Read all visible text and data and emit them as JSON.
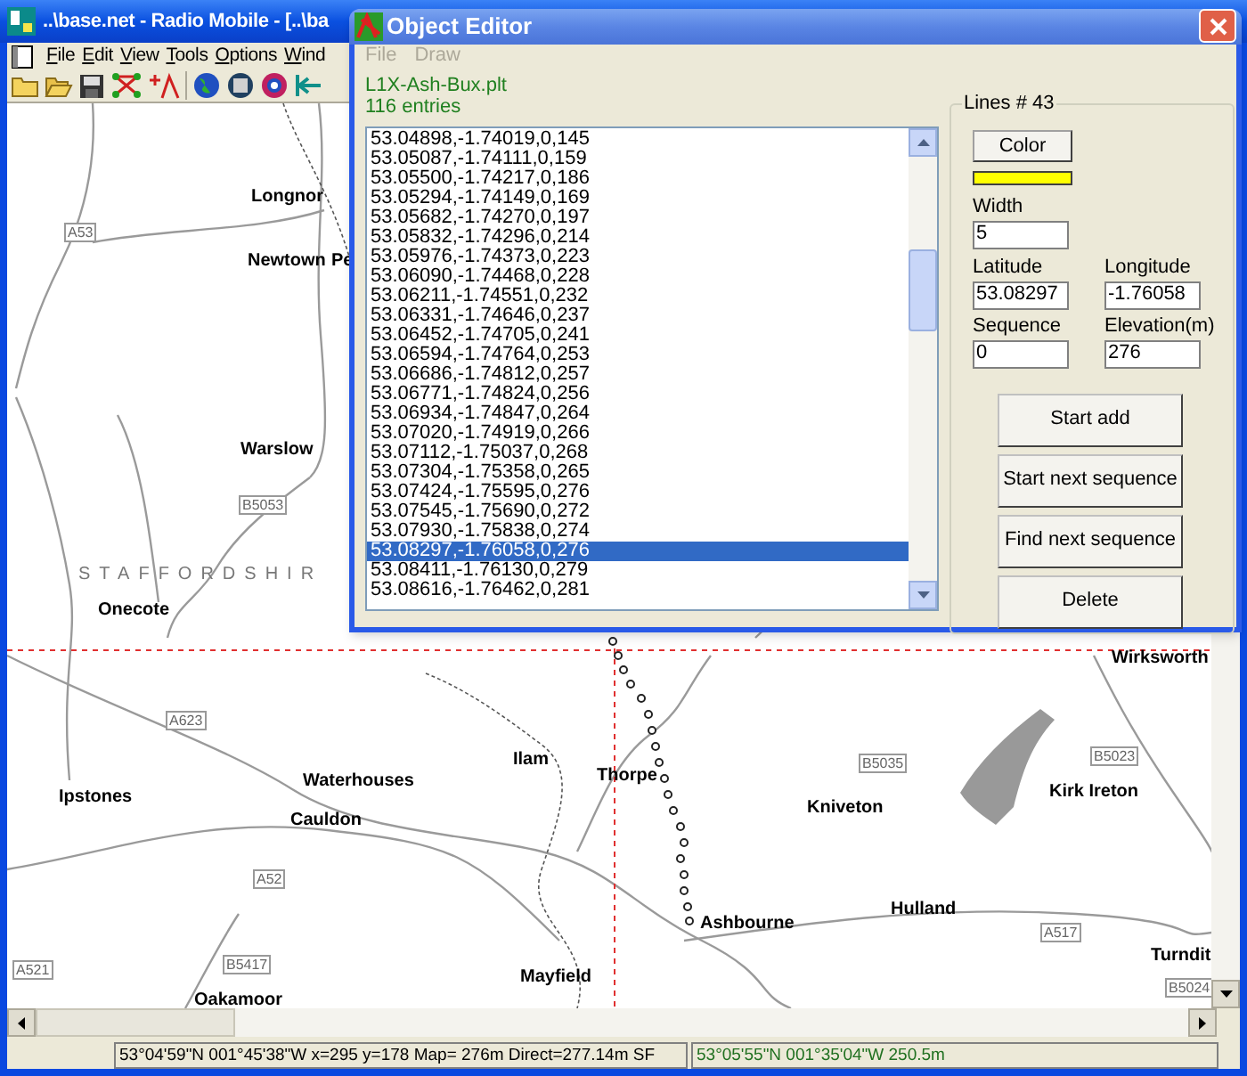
{
  "main_window": {
    "title": "..\\base.net - Radio Mobile - [..\\ba"
  },
  "menu": [
    "File",
    "Edit",
    "View",
    "Tools",
    "Options",
    "Wind"
  ],
  "map": {
    "labels": [
      {
        "text": "Longnor",
        "kind": "town"
      },
      {
        "text": "Newtown",
        "kind": "town"
      },
      {
        "text": "Pe",
        "kind": "town"
      },
      {
        "text": "A53",
        "kind": "road"
      },
      {
        "text": "Warslow",
        "kind": "town"
      },
      {
        "text": "B5053",
        "kind": "road"
      },
      {
        "text": "STAFFORDSHIR",
        "kind": "county"
      },
      {
        "text": "Onecote",
        "kind": "town"
      },
      {
        "text": "Wirksworth",
        "kind": "town"
      },
      {
        "text": "A623",
        "kind": "road"
      },
      {
        "text": "Ilam",
        "kind": "town"
      },
      {
        "text": "Thorpe",
        "kind": "town"
      },
      {
        "text": "B5035",
        "kind": "road"
      },
      {
        "text": "B5023",
        "kind": "road"
      },
      {
        "text": "Waterhouses",
        "kind": "town"
      },
      {
        "text": "Ipstones",
        "kind": "town"
      },
      {
        "text": "Kirk Ireton",
        "kind": "town"
      },
      {
        "text": "Kniveton",
        "kind": "town"
      },
      {
        "text": "Cauldon",
        "kind": "town"
      },
      {
        "text": "A52",
        "kind": "road"
      },
      {
        "text": "Hulland",
        "kind": "town"
      },
      {
        "text": "Ashbourne",
        "kind": "town"
      },
      {
        "text": "A517",
        "kind": "road"
      },
      {
        "text": "B5417",
        "kind": "road"
      },
      {
        "text": "A521",
        "kind": "road"
      },
      {
        "text": "Turndit",
        "kind": "town"
      },
      {
        "text": "Mayfield",
        "kind": "town"
      },
      {
        "text": "B5024",
        "kind": "road"
      },
      {
        "text": "Oakamoor",
        "kind": "town"
      }
    ]
  },
  "status_bar": {
    "cursor": "53°04'59\"N  001°45'38\"W  x=295 y=178 Map= 276m Direct=277.14m SF",
    "marker": "53°05'55\"N 001°35'04\"W 250.5m"
  },
  "object_editor": {
    "title": "Object Editor",
    "menu": [
      {
        "label": "File",
        "disabled": true
      },
      {
        "label": "Draw",
        "disabled": true
      }
    ],
    "file_name": "L1X-Ash-Bux.plt",
    "entry_count": "116 entries",
    "points": [
      {
        "text": "53.04898,-1.74019,0,145",
        "selected": false
      },
      {
        "text": "53.05087,-1.74111,0,159",
        "selected": false
      },
      {
        "text": "53.05500,-1.74217,0,186",
        "selected": false
      },
      {
        "text": "53.05294,-1.74149,0,169",
        "selected": false
      },
      {
        "text": "53.05682,-1.74270,0,197",
        "selected": false
      },
      {
        "text": "53.05832,-1.74296,0,214",
        "selected": false
      },
      {
        "text": "53.05976,-1.74373,0,223",
        "selected": false
      },
      {
        "text": "53.06090,-1.74468,0,228",
        "selected": false
      },
      {
        "text": "53.06211,-1.74551,0,232",
        "selected": false
      },
      {
        "text": "53.06331,-1.74646,0,237",
        "selected": false
      },
      {
        "text": "53.06452,-1.74705,0,241",
        "selected": false
      },
      {
        "text": "53.06594,-1.74764,0,253",
        "selected": false
      },
      {
        "text": "53.06686,-1.74812,0,257",
        "selected": false
      },
      {
        "text": "53.06771,-1.74824,0,256",
        "selected": false
      },
      {
        "text": "53.06934,-1.74847,0,264",
        "selected": false
      },
      {
        "text": "53.07020,-1.74919,0,266",
        "selected": false
      },
      {
        "text": "53.07112,-1.75037,0,268",
        "selected": false
      },
      {
        "text": "53.07304,-1.75358,0,265",
        "selected": false
      },
      {
        "text": "53.07424,-1.75595,0,276",
        "selected": false
      },
      {
        "text": "53.07545,-1.75690,0,272",
        "selected": false
      },
      {
        "text": "53.07930,-1.75838,0,274",
        "selected": false
      },
      {
        "text": "53.08297,-1.76058,0,276",
        "selected": true
      },
      {
        "text": "53.08411,-1.76130,0,279",
        "selected": false
      },
      {
        "text": "53.08616,-1.76462,0,281",
        "selected": false
      }
    ],
    "group_title": "Lines # 43",
    "color_button": "Color",
    "swatch": {
      "color": "#ffff00"
    },
    "width": {
      "label": "Width",
      "value": "5"
    },
    "fields": [
      {
        "label": "Latitude",
        "value": "53.08297"
      },
      {
        "label": "Longitude",
        "value": "-1.76058"
      },
      {
        "label": "Sequence",
        "value": "0"
      },
      {
        "label": "Elevation(m)",
        "value": "276"
      }
    ],
    "buttons": [
      "Start add",
      "Start next sequence",
      "Find next sequence",
      "Delete"
    ]
  }
}
